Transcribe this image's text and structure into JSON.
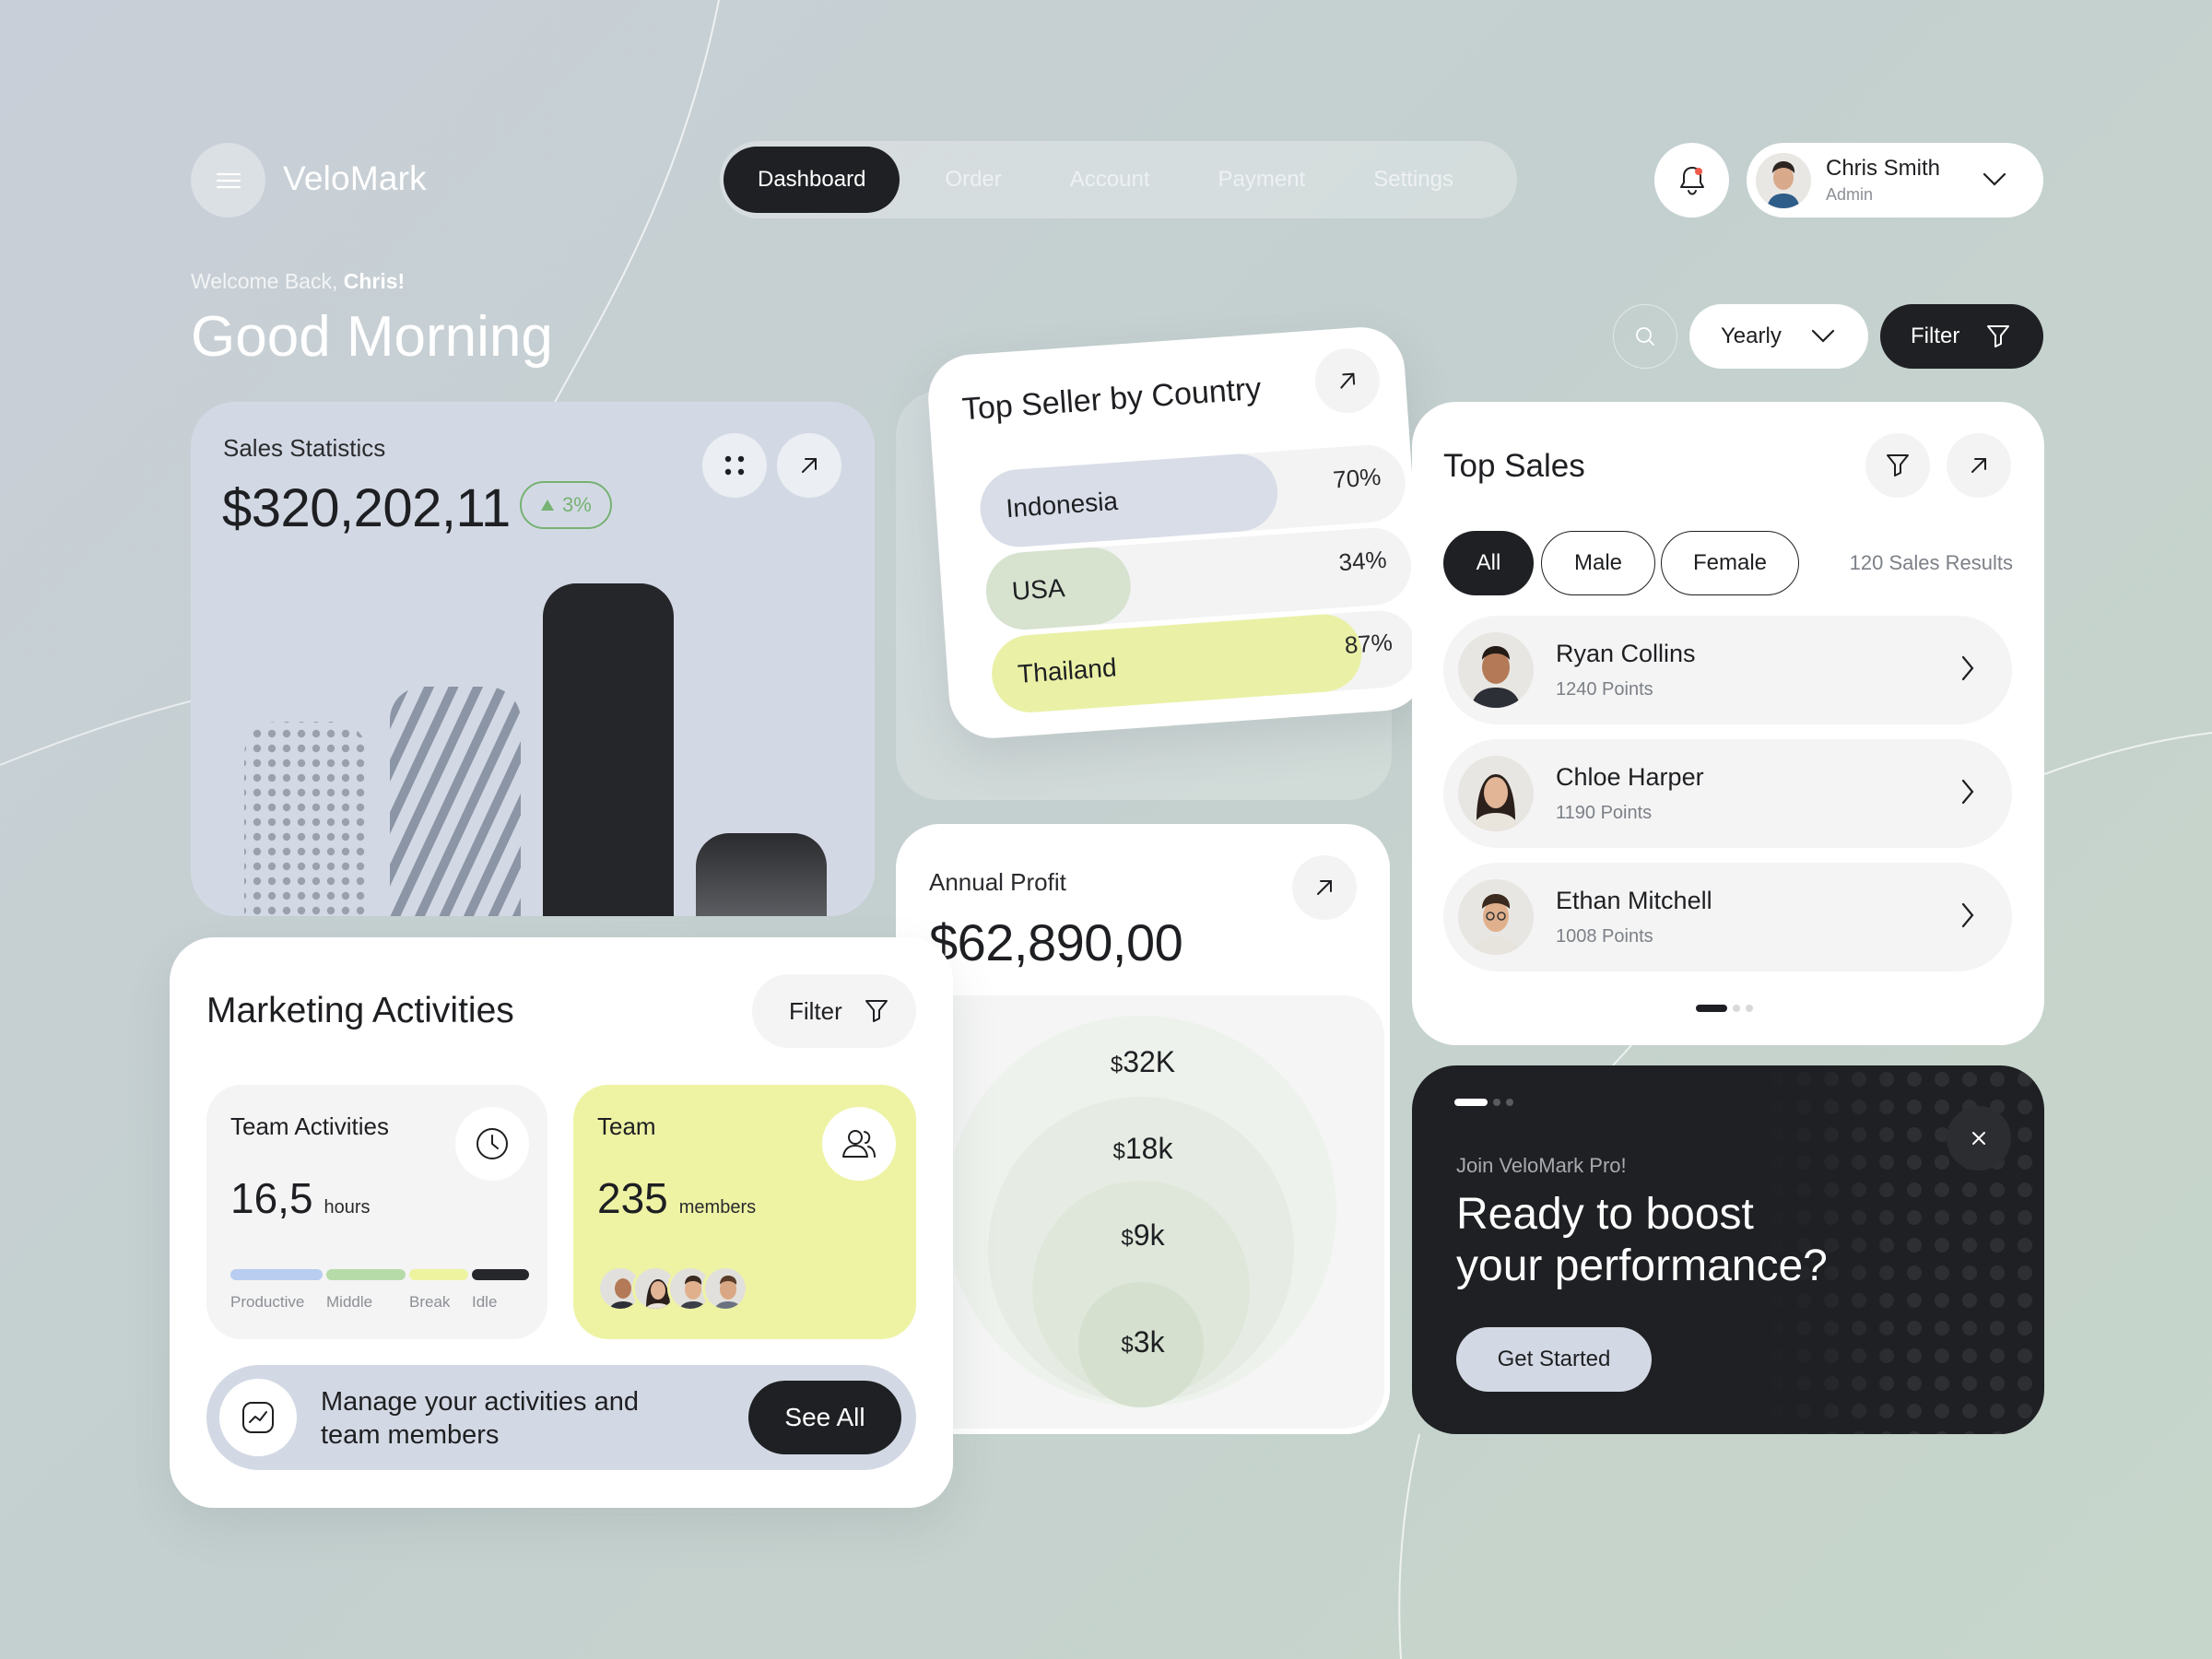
{
  "brand": "VeloMark",
  "nav": [
    {
      "label": "Dashboard",
      "active": true
    },
    {
      "label": "Order",
      "active": false
    },
    {
      "label": "Account",
      "active": false
    },
    {
      "label": "Payment",
      "active": false
    },
    {
      "label": "Settings",
      "active": false
    }
  ],
  "user": {
    "name": "Chris Smith",
    "role": "Admin"
  },
  "welcome": {
    "prefix": "Welcome Back, ",
    "name": "Chris!"
  },
  "greeting": "Good Morning",
  "controls": {
    "period": "Yearly",
    "filter": "Filter"
  },
  "sales_statistics": {
    "title": "Sales Statistics",
    "value": "$320,202,11",
    "change": "3%",
    "bar_levels": [
      0.49,
      0.58,
      0.84,
      0.21
    ]
  },
  "top_seller": {
    "title": "Top Seller by Country",
    "countries": [
      {
        "name": "Indonesia",
        "percent": "70%",
        "value": 70,
        "color": "#d8dde8"
      },
      {
        "name": "USA",
        "percent": "34%",
        "value": 34,
        "color": "#d7e2cf"
      },
      {
        "name": "Thailand",
        "percent": "87%",
        "value": 87,
        "color": "#eaf1a6"
      }
    ]
  },
  "annual_profit": {
    "title": "Annual Profit",
    "value": "$62,890,00",
    "rings": [
      {
        "currency": "$",
        "amount": "32K"
      },
      {
        "currency": "$",
        "amount": "18k"
      },
      {
        "currency": "$",
        "amount": "9k"
      },
      {
        "currency": "$",
        "amount": "3k"
      }
    ]
  },
  "top_sales": {
    "title": "Top Sales",
    "tabs": [
      {
        "label": "All",
        "active": true
      },
      {
        "label": "Male",
        "active": false
      },
      {
        "label": "Female",
        "active": false
      }
    ],
    "results": "120 Sales Results",
    "people": [
      {
        "name": "Ryan Collins",
        "points": "1240 Points"
      },
      {
        "name": "Chloe Harper",
        "points": "1190 Points"
      },
      {
        "name": "Ethan Mitchell",
        "points": "1008 Points"
      }
    ]
  },
  "promo": {
    "eyebrow": "Join VeloMark Pro!",
    "headline_1": "Ready to boost",
    "headline_2": "your performance?",
    "cta": "Get Started"
  },
  "marketing": {
    "title": "Marketing Activities",
    "filter": "Filter",
    "team_activities": {
      "title": "Team Activities",
      "value": "16,5",
      "unit": "hours",
      "segments": [
        {
          "label": "Productive",
          "color": "#b8cdf0"
        },
        {
          "label": "Middle",
          "color": "#b6dba8"
        },
        {
          "label": "Break",
          "color": "#eef3a0"
        },
        {
          "label": "Idle",
          "color": "#26272a"
        }
      ]
    },
    "team": {
      "title": "Team",
      "value": "235",
      "unit": "members"
    },
    "manage_text_1": "Manage your activities and",
    "manage_text_2": "team members",
    "see_all": "See All"
  }
}
